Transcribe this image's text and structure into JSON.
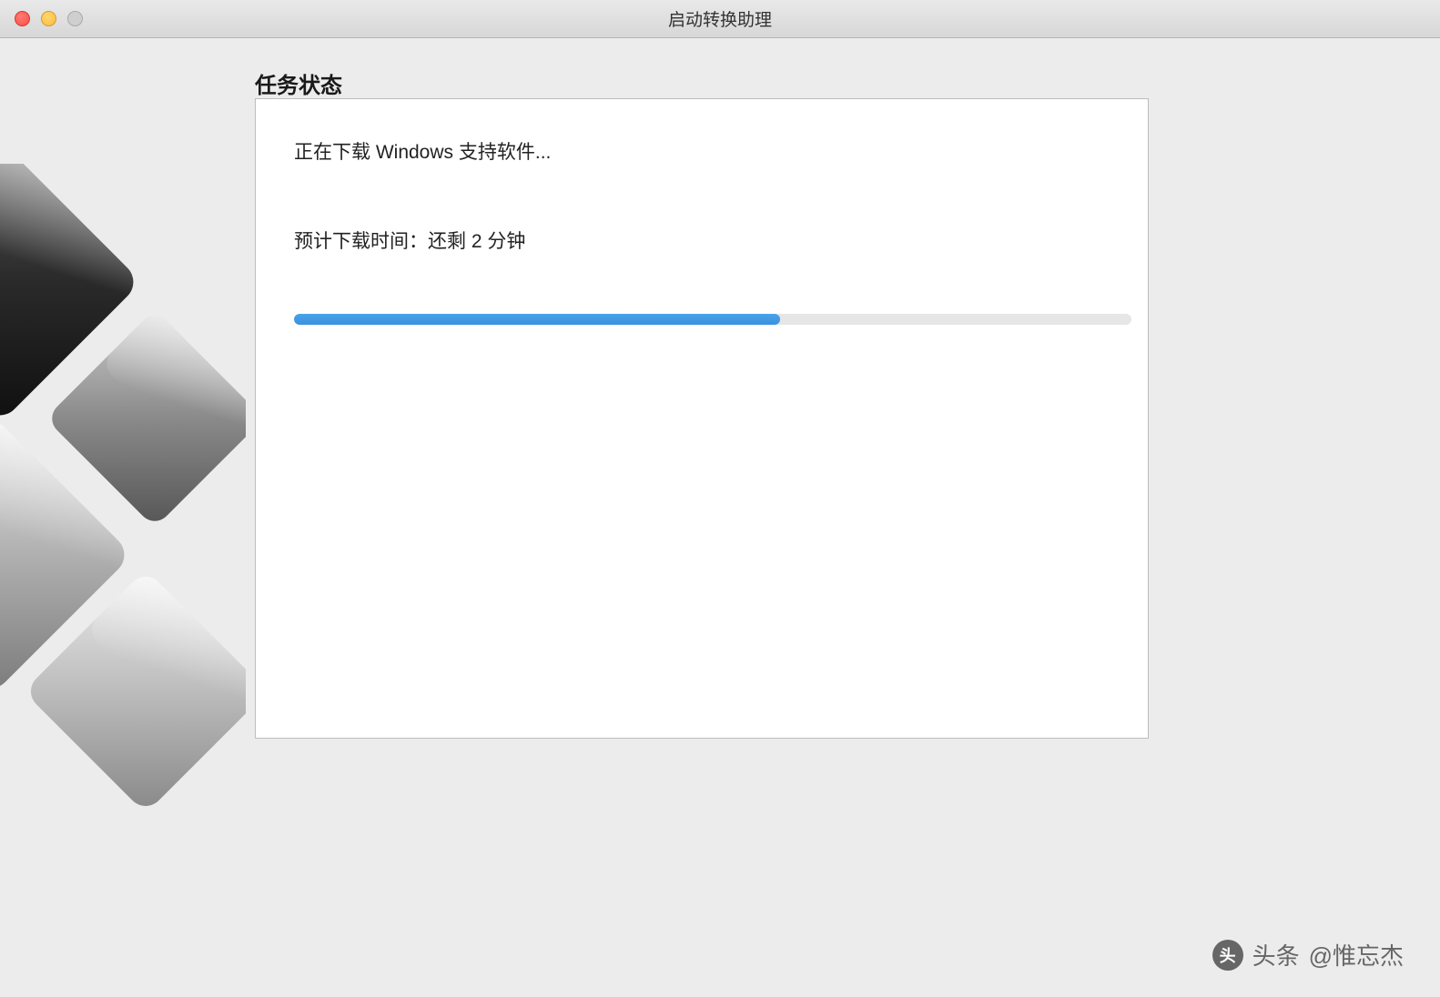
{
  "window": {
    "title": "启动转换助理"
  },
  "section": {
    "heading": "任务状态"
  },
  "status": {
    "current_action": "正在下载 Windows 支持软件...",
    "estimate_label": "预计下载时间：还剩 2 分钟"
  },
  "progress": {
    "percent": 58
  },
  "watermark": {
    "prefix": "头条",
    "handle": "@惟忘杰"
  }
}
